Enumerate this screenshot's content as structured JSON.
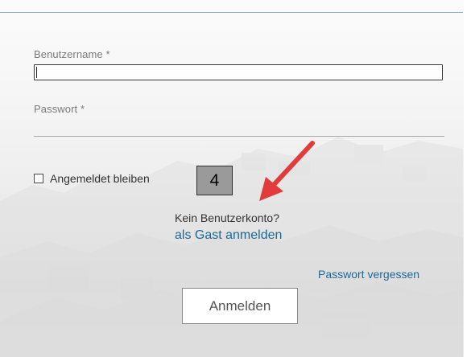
{
  "form": {
    "username_label": "Benutzername *",
    "username_value": "",
    "password_label": "Passwort *",
    "password_value": "",
    "remember_label": "Angemeldet bleiben",
    "remember_checked": false,
    "no_account_text": "Kein Benutzerkonto?",
    "guest_link": "als Gast anmelden",
    "forgot_password_link": "Passwort vergessen",
    "login_button": "Anmelden"
  },
  "annotation": {
    "step_number": "4",
    "arrow_color": "#e23b3b"
  },
  "colors": {
    "link": "#1a6a97",
    "top_border": "#8fb0cf"
  }
}
